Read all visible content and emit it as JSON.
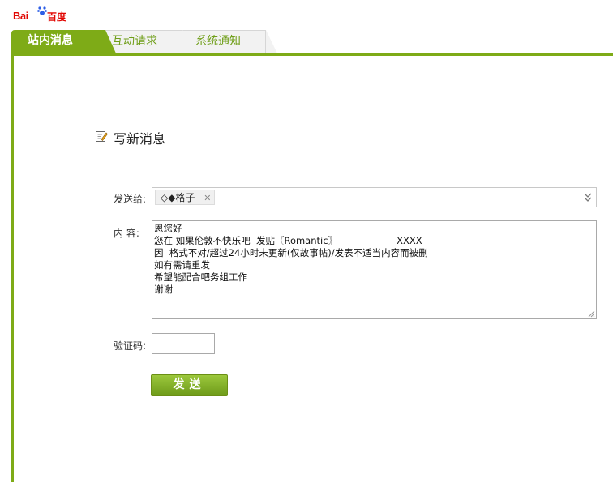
{
  "logo": {
    "text_latin": "Bai",
    "text_cn": "百度"
  },
  "tabs": [
    {
      "label": "站内消息",
      "active": true
    },
    {
      "label": "互动请求",
      "active": false
    },
    {
      "label": "系统通知",
      "active": false
    }
  ],
  "compose": {
    "heading": "写新消息",
    "to_label": "发送给:",
    "recipient": "◇◆格子",
    "content_label": "内 容:",
    "content_lines": [
      "恩您好",
      "",
      "您在 如果伦敦不快乐吧  发贴〖Romantic〗                    XXXX",
      "因  格式不对/超过24小时未更新(仅故事帖)/发表不适当内容而被删",
      "如有需请重发",
      "希望能配合吧务组工作",
      "谢谢"
    ],
    "captcha_label": "验证码:",
    "captcha_value": "",
    "send_label": "发送"
  },
  "colors": {
    "accent": "#7eab17",
    "logo_red": "#e10602"
  }
}
